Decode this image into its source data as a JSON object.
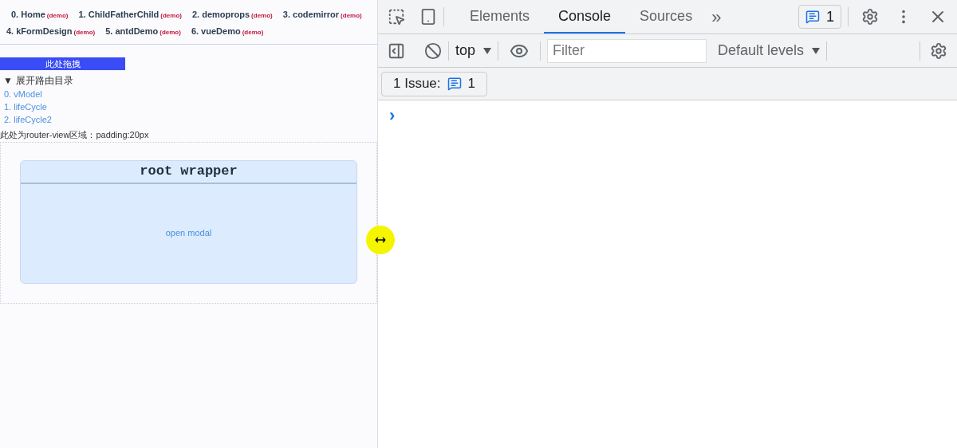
{
  "nav": [
    {
      "label": "0. Home",
      "tag": "(demo)"
    },
    {
      "label": "1. ChildFatherChild",
      "tag": "(demo)"
    },
    {
      "label": "2. demoprops",
      "tag": "(demo)"
    },
    {
      "label": "3. codemirror",
      "tag": "(demo)"
    },
    {
      "label": "4. kFormDesign",
      "tag": "(demo)"
    },
    {
      "label": "5. antdDemo",
      "tag": "(demo)"
    },
    {
      "label": "6. vueDemo",
      "tag": "(demo)"
    }
  ],
  "drag_handle": "此处拖拽",
  "route_menu": {
    "toggle": "▼",
    "title": "展开路由目录",
    "expanded": true,
    "links": [
      "0. vModel",
      "1. lifeCycle",
      "2. lifeCycle2"
    ]
  },
  "router_note": "此处为router-view区域：padding:20px",
  "card": {
    "title": "root wrapper",
    "link": "open modal"
  },
  "devtools": {
    "tabs": [
      {
        "label": "Elements",
        "selected": false
      },
      {
        "label": "Console",
        "selected": true
      },
      {
        "label": "Sources",
        "selected": false
      }
    ],
    "more": "»",
    "issues_badge": "1",
    "context": "top",
    "filter": {
      "placeholder": "Filter"
    },
    "levels": "Default levels",
    "issue_button": {
      "label": "1 Issue:",
      "count": "1"
    },
    "prompt": "›"
  }
}
